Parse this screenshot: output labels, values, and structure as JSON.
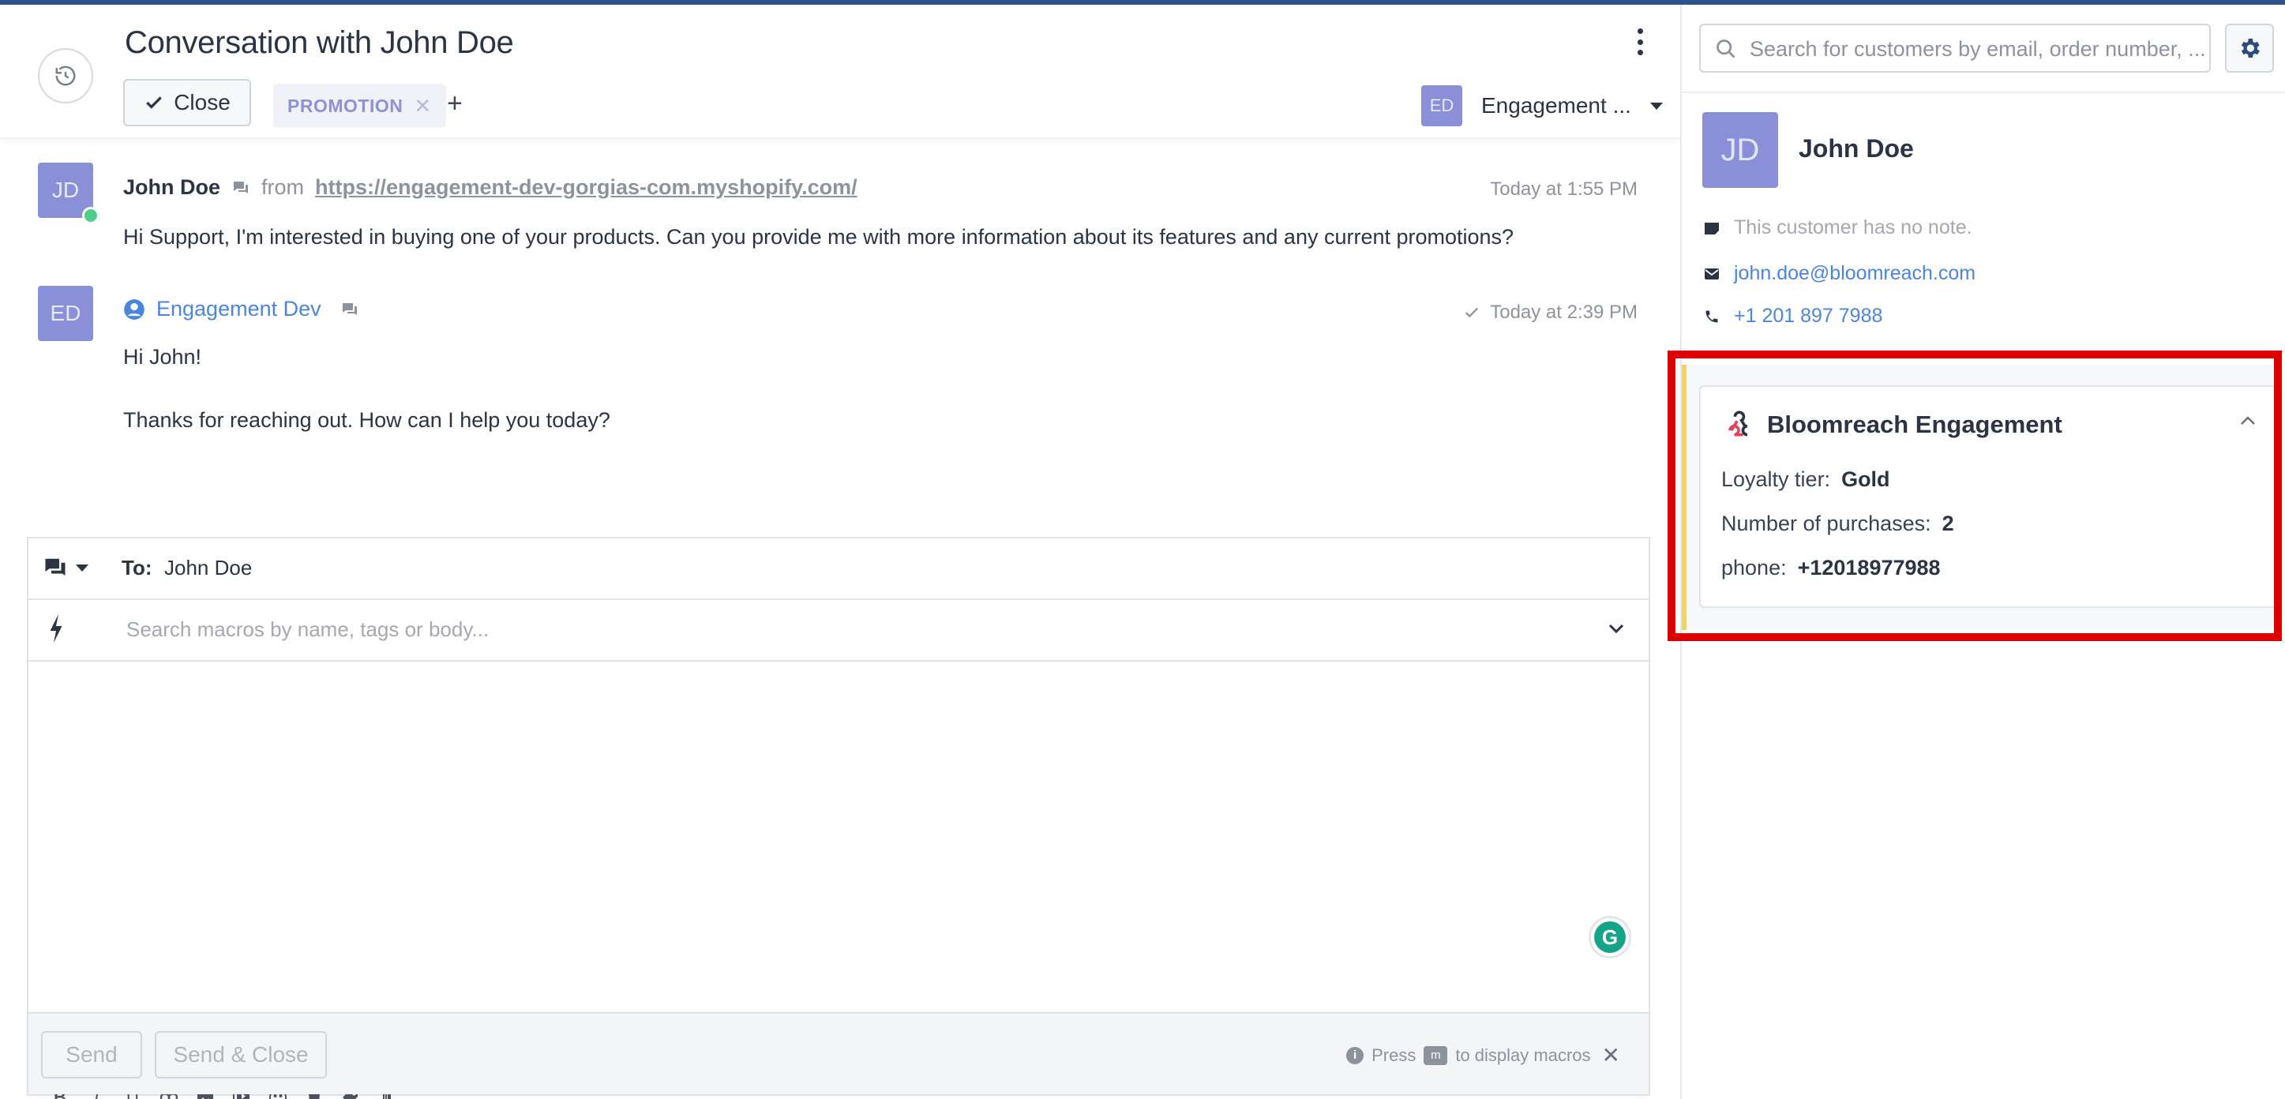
{
  "header": {
    "title": "Conversation with John Doe",
    "close_label": "Close",
    "tags": [
      {
        "label": "PROMOTION",
        "color": "#8e90d8"
      }
    ],
    "add_tag_label": "+",
    "assignee": {
      "initials": "ED",
      "name": "Engagement ..."
    }
  },
  "messages": [
    {
      "initials": "JD",
      "sender": "John Doe",
      "from_label": "from",
      "source_url": "https://engagement-dev-gorgias-com.myshopify.com/",
      "time": "Today at 1:55 PM",
      "body": "Hi Support, I'm interested in buying one of your products. Can you provide me with more information about its features and any current promotions?"
    },
    {
      "initials": "ED",
      "sender": "Engagement Dev",
      "time": "Today at 2:39 PM",
      "body_lines": [
        "Hi John!",
        "Thanks for reaching out. How can I help you today?"
      ]
    }
  ],
  "composer": {
    "to_label": "To:",
    "to_value": "John Doe",
    "macro_placeholder": "Search macros by name, tags or body...",
    "send_label": "Send",
    "send_close_label": "Send & Close",
    "hint_press": "Press",
    "hint_key": "m",
    "hint_rest": "to display macros",
    "grammarly_letter": "G",
    "format_tools": [
      "B",
      "I",
      "U"
    ]
  },
  "sidebar": {
    "search_placeholder": "Search for customers by email, order number, ...",
    "customer": {
      "initials": "JD",
      "name": "John Doe",
      "note": "This customer has no note.",
      "email": "john.doe@bloomreach.com",
      "phone": "+1 201 897 7988"
    },
    "widget": {
      "title": "Bloomreach Engagement",
      "fields": [
        {
          "label": "Loyalty tier:",
          "value": "Gold"
        },
        {
          "label": "Number of purchases:",
          "value": "2"
        },
        {
          "label": "phone:",
          "value": "+12018977988"
        }
      ],
      "accent_color": "#f3d266",
      "highlight_color": "#dc0000"
    }
  }
}
